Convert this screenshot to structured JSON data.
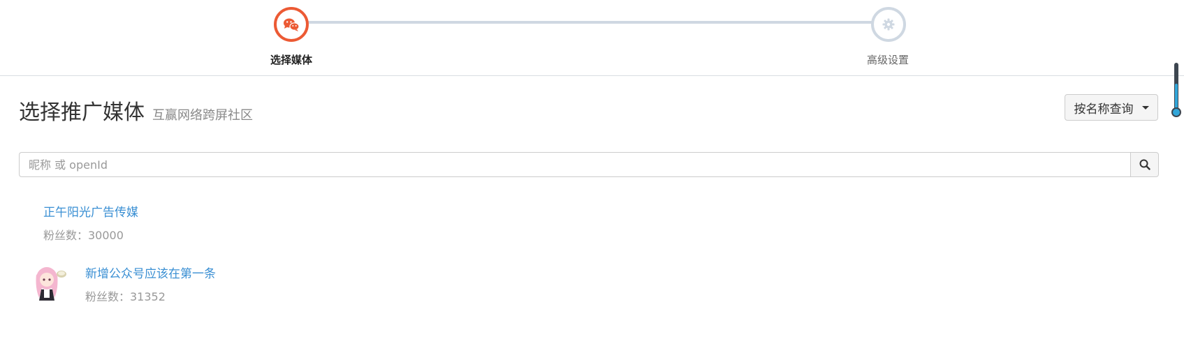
{
  "stepper": {
    "steps": [
      {
        "label": "选择媒体",
        "icon": "wechat-icon",
        "active": true
      },
      {
        "label": "高级设置",
        "icon": "gear-icon",
        "active": false
      }
    ],
    "active_color": "#ec5a34",
    "inactive_color": "#cfd8e2"
  },
  "heading": {
    "title": "选择推广媒体",
    "subtitle": "互赢网络跨屏社区"
  },
  "search_type": {
    "label": "按名称查询"
  },
  "search": {
    "placeholder": "昵称 或 openId",
    "value": ""
  },
  "media": [
    {
      "name": "正午阳光广告传媒",
      "fans": "粉丝数：30000",
      "has_avatar": false
    },
    {
      "name": "新增公众号应该在第一条",
      "fans": "粉丝数：31352",
      "has_avatar": true
    }
  ],
  "link_color": "#3a8fd3"
}
